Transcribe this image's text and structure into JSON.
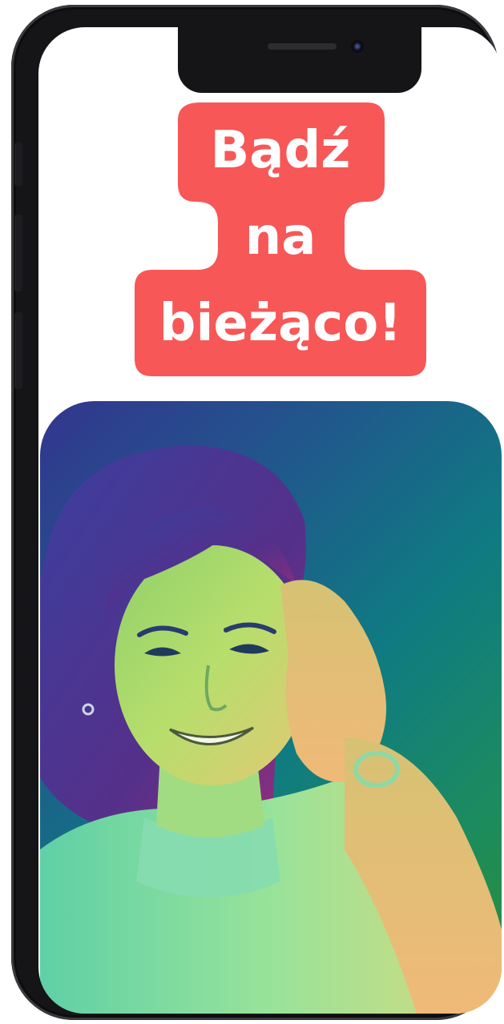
{
  "headline": {
    "line1": "Bądź",
    "line2": "na",
    "line3": "bieżąco!"
  },
  "colors": {
    "headline_bg": "#f75757",
    "headline_text": "#ffffff",
    "phone_frame": "#151517",
    "screen_bg": "#ffffff"
  },
  "photo": {
    "subject": "smiling-woman-gradient-portrait"
  }
}
